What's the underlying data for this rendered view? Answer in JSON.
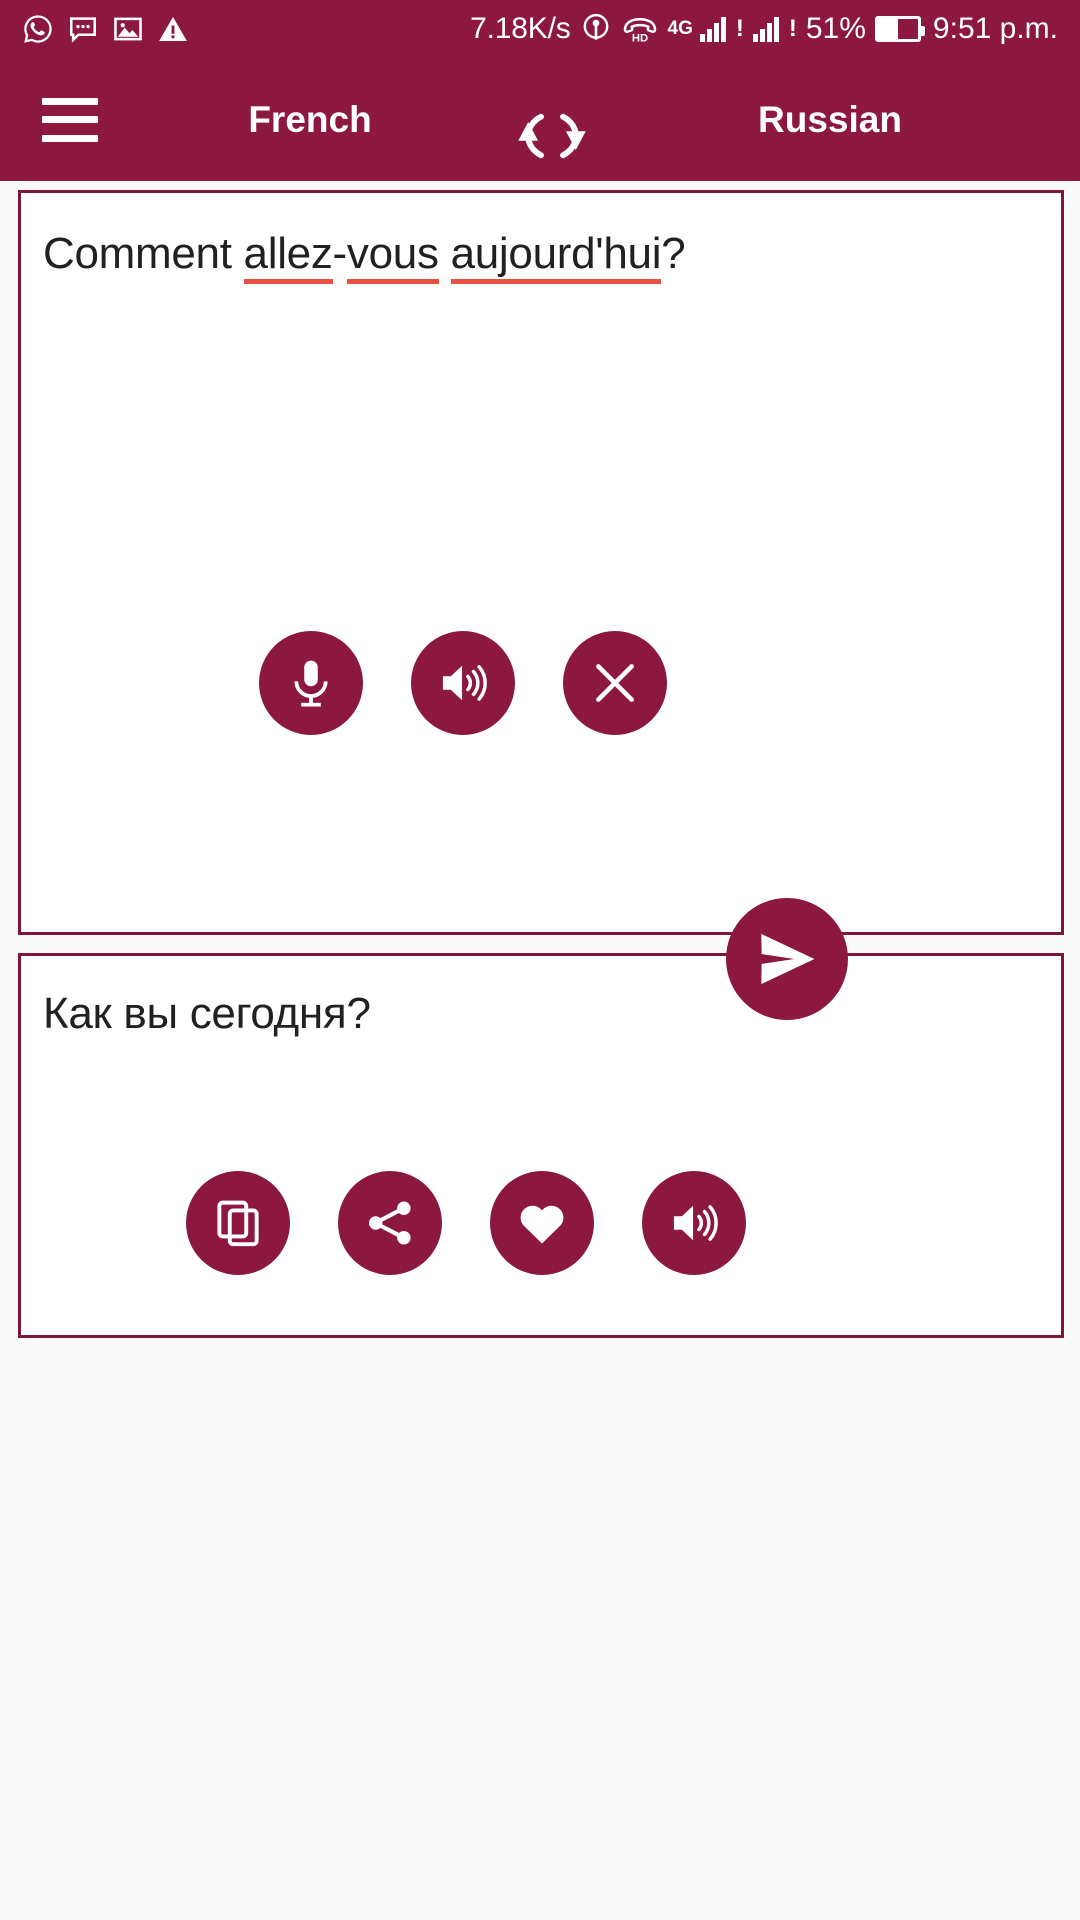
{
  "status_bar": {
    "network_speed": "7.18K/s",
    "network_type": "4G",
    "hd_label": "HD",
    "battery_percent": "51%",
    "battery_level": 51,
    "time": "9:51 p.m.",
    "left_icons": [
      "whatsapp-icon",
      "message-icon",
      "image-icon",
      "warning-icon"
    ],
    "right_icons": [
      "hotspot-icon",
      "hd-voice-icon",
      "signal-sim1-icon",
      "signal-sim2-icon",
      "battery-icon"
    ],
    "background_color": "#8c1840",
    "foreground_color": "#ffffff"
  },
  "app_bar": {
    "menu_label": "menu",
    "source_language": "French",
    "target_language": "Russian",
    "swap_label": "swap languages",
    "background_color": "#8c1840"
  },
  "source_card": {
    "text": "Comment allez-vous aujourd'hui?",
    "segments": [
      {
        "text": "Comment ",
        "misspelled": false
      },
      {
        "text": "allez",
        "misspelled": true
      },
      {
        "text": "-",
        "misspelled": false
      },
      {
        "text": "vous",
        "misspelled": true
      },
      {
        "text": " ",
        "misspelled": false
      },
      {
        "text": "aujourd'hui",
        "misspelled": true
      },
      {
        "text": "?",
        "misspelled": false
      }
    ],
    "spellcheck_underline_color": "#e8503f",
    "actions": [
      {
        "name": "microphone-button",
        "label": "Speak / voice input"
      },
      {
        "name": "speak-source-button",
        "label": "Listen to source text"
      },
      {
        "name": "clear-button",
        "label": "Clear text"
      }
    ]
  },
  "translate_button": {
    "name": "send-translate-button",
    "label": "Translate"
  },
  "target_card": {
    "text": "Как вы сегодня?",
    "actions": [
      {
        "name": "copy-button",
        "label": "Copy translation"
      },
      {
        "name": "share-button",
        "label": "Share translation"
      },
      {
        "name": "favorite-button",
        "label": "Add to favorites"
      },
      {
        "name": "speak-target-button",
        "label": "Listen to translation"
      }
    ]
  },
  "theme": {
    "primary": "#8c1840",
    "card_border": "#7d1739",
    "text_color": "#212121",
    "page_background": "#fafafa"
  }
}
